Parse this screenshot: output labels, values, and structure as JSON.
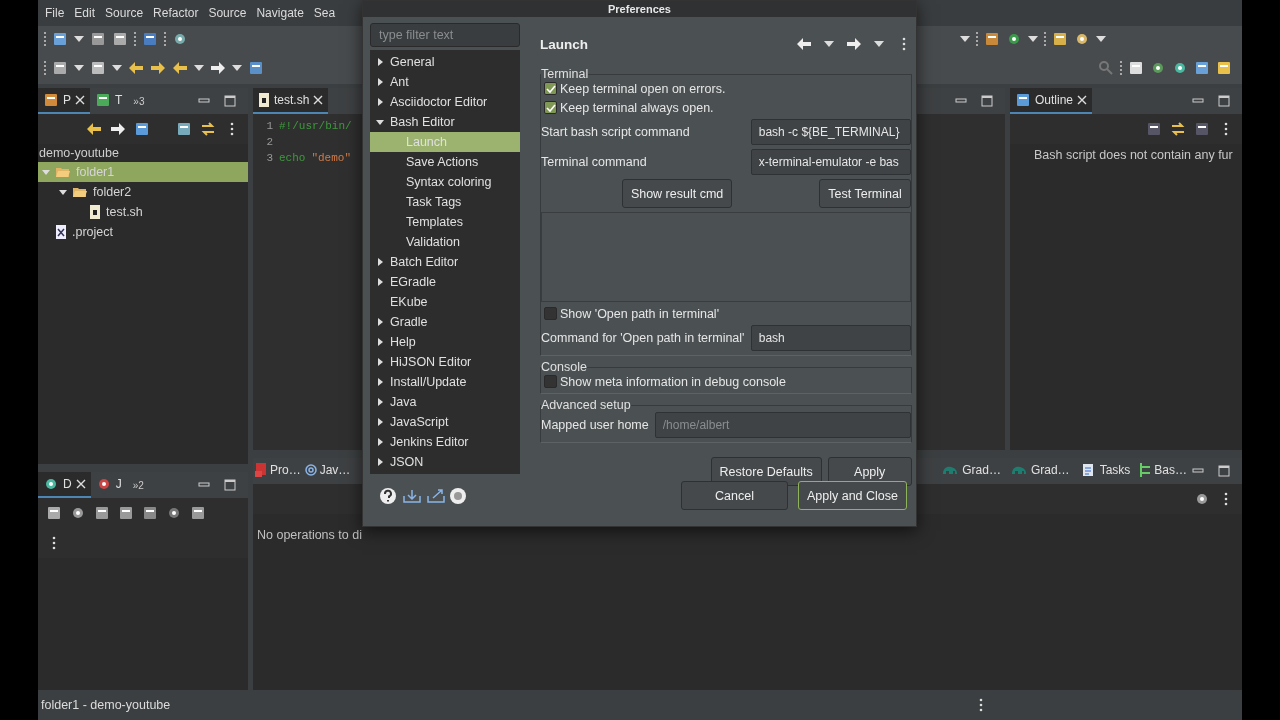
{
  "menu": [
    "File",
    "Edit",
    "Source",
    "Refactor",
    "Source",
    "Navigate",
    "Sea"
  ],
  "explorer": {
    "tabs": [
      {
        "label": "P",
        "selected": true
      },
      {
        "label": "T",
        "selected": false
      }
    ],
    "overflow": "»3",
    "project": "demo-youtube",
    "tree": [
      {
        "label": "folder1",
        "kind": "folder",
        "expanded": true,
        "selected": true,
        "children": [
          {
            "label": "folder2",
            "kind": "folder",
            "expanded": true,
            "selected": false,
            "children": [
              {
                "label": "test.sh",
                "kind": "script",
                "selected": false
              }
            ]
          }
        ]
      },
      {
        "label": ".project",
        "kind": "xml",
        "selected": false
      }
    ]
  },
  "editor": {
    "tab": "test.sh",
    "lines": [
      {
        "number": "1",
        "tokens": [
          {
            "kind": "comment",
            "text": "#!/usr/bin/"
          }
        ]
      },
      {
        "number": "2"
      },
      {
        "number": "3",
        "tokens": [
          {
            "kind": "keyword",
            "text": "echo"
          },
          {
            "kind": "string",
            "text": "\"demo\""
          }
        ]
      }
    ]
  },
  "outline": {
    "tab": "Outline",
    "message": "Bash script does not contain any fur"
  },
  "debug": {
    "tabs": [
      {
        "label": "D",
        "selected": true
      },
      {
        "label": "J",
        "selected": false
      }
    ],
    "overflow": "»2"
  },
  "bottom": {
    "tabs_left": [
      {
        "label": "Pro…",
        "kind": "problems"
      },
      {
        "label": "Jav…",
        "kind": "javadoc"
      }
    ],
    "tabs_right": [
      {
        "label": "Grad…",
        "kind": "gradle"
      },
      {
        "label": "Grad…",
        "kind": "gradle"
      },
      {
        "label": "Tasks",
        "kind": "tasks"
      },
      {
        "label": "Bas…",
        "kind": "bash"
      }
    ],
    "message": "No operations to di"
  },
  "status_bar": "folder1 - demo-youtube",
  "dialog": {
    "title": "Preferences",
    "filter": {
      "placeholder": "type filter text"
    },
    "nav": [
      {
        "label": "General",
        "kind": "group",
        "expanded": false
      },
      {
        "label": "Ant",
        "kind": "group",
        "expanded": false
      },
      {
        "label": "Asciidoctor Editor",
        "kind": "group",
        "expanded": false
      },
      {
        "label": "Bash Editor",
        "kind": "group",
        "expanded": true,
        "children": [
          {
            "label": "Launch",
            "selected": true
          },
          {
            "label": "Save Actions",
            "selected": false
          },
          {
            "label": "Syntax coloring",
            "selected": false
          },
          {
            "label": "Task Tags",
            "selected": false
          },
          {
            "label": "Templates",
            "selected": false
          },
          {
            "label": "Validation",
            "selected": false
          }
        ]
      },
      {
        "label": "Batch Editor",
        "kind": "group",
        "expanded": false
      },
      {
        "label": "EGradle",
        "kind": "group",
        "expanded": false
      },
      {
        "label": "EKube",
        "kind": "leaf"
      },
      {
        "label": "Gradle",
        "kind": "group",
        "expanded": false
      },
      {
        "label": "Help",
        "kind": "group",
        "expanded": false
      },
      {
        "label": "HiJSON Editor",
        "kind": "group",
        "expanded": false
      },
      {
        "label": "Install/Update",
        "kind": "group",
        "expanded": false
      },
      {
        "label": "Java",
        "kind": "group",
        "expanded": false
      },
      {
        "label": "JavaScript",
        "kind": "group",
        "expanded": false
      },
      {
        "label": "Jenkins Editor",
        "kind": "group",
        "expanded": false
      },
      {
        "label": "JSON",
        "kind": "group",
        "expanded": false
      }
    ],
    "heading": "Launch",
    "terminal": {
      "legend": "Terminal",
      "options": [
        {
          "label": "Keep terminal open on errors.",
          "checked": true
        },
        {
          "label": "Keep terminal always open.",
          "checked": true
        }
      ],
      "fields": [
        {
          "label": "Start bash script command",
          "value": "bash -c ${BE_TERMINAL}"
        },
        {
          "label": "Terminal command",
          "value": "x-terminal-emulator -e bas"
        }
      ],
      "buttons": [
        "Show result cmd",
        "Test Terminal"
      ],
      "open_path": {
        "label": "Show 'Open path in terminal'",
        "checked": false
      },
      "open_path_command": {
        "label": "Command for 'Open path in terminal'",
        "value": "bash"
      }
    },
    "console": {
      "legend": "Console",
      "option": {
        "label": "Show meta information in debug console",
        "checked": false
      }
    },
    "advanced": {
      "legend": "Advanced setup",
      "field": {
        "label": "Mapped user home",
        "placeholder": "/home/albert"
      }
    },
    "buttons": [
      "Restore Defaults",
      "Apply"
    ],
    "footer_buttons": [
      {
        "label": "Cancel",
        "default": false
      },
      {
        "label": "Apply and Close",
        "default": true
      }
    ]
  }
}
